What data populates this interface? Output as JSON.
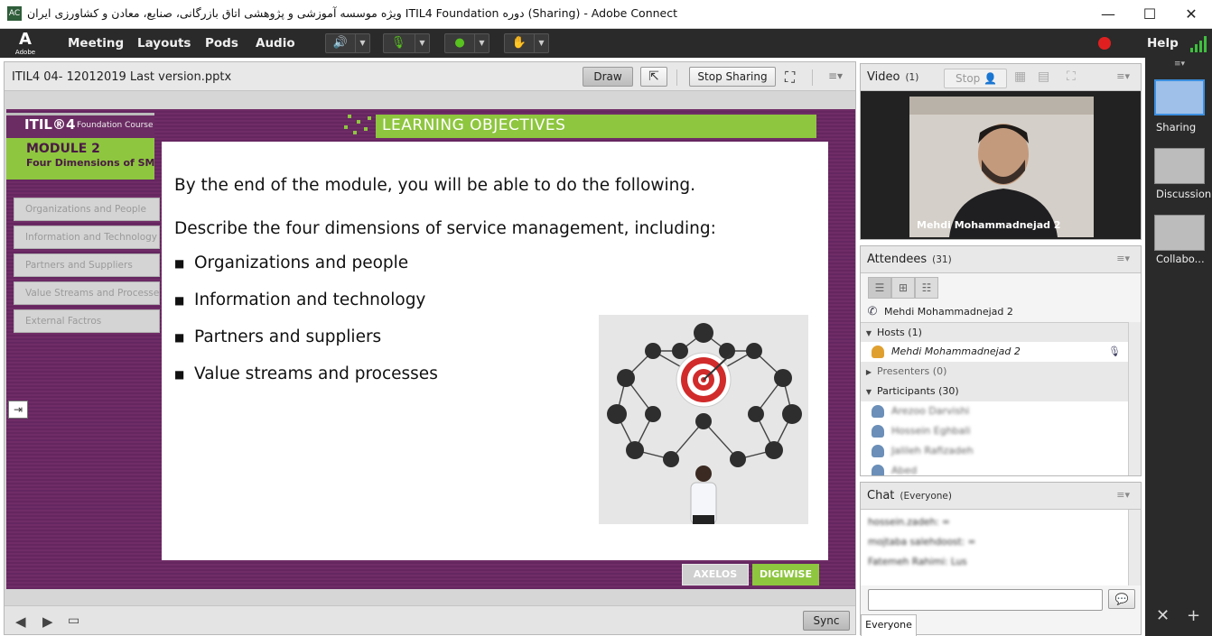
{
  "window": {
    "title": "ویژه موسسه آموزشی و پژوهشی اتاق بازرگانی، صنایع، معادن و کشاورزی ایران ITIL4 Foundation دوره (Sharing) - Adobe Connect",
    "minimize": "—",
    "maximize": "☐",
    "close": "✕"
  },
  "menubar": {
    "logo": "Adobe",
    "items": [
      "Meeting",
      "Layouts",
      "Pods",
      "Audio"
    ],
    "help": "Help"
  },
  "share_pod": {
    "filename": "ITIL4 04- 12012019 Last version.pptx",
    "draw_label": "Draw",
    "stop_sharing_label": "Stop Sharing",
    "sync_label": "Sync"
  },
  "slide": {
    "brand": "ITIL®4",
    "brand_sub": "Foundation Course",
    "module_title": "MODULE 2",
    "module_sub": "Four Dimensions of SM",
    "side_items": [
      "Organizations and People",
      "Information and Technology",
      "Partners and Suppliers",
      "Value Streams and Processes",
      "External Factros"
    ],
    "header": "LEARNING OBJECTIVES",
    "lead": "By the end of the module, you will be able to do the following.",
    "desc": "Describe the four dimensions of service management, including:",
    "bullets": [
      "Organizations and people",
      "Information and technology",
      "Partners and suppliers",
      "Value streams and processes"
    ],
    "logo_left": "AXELOS",
    "logo_right": "DIGIWISE"
  },
  "video_pod": {
    "title": "Video",
    "count": "(1)",
    "stop_label": "Stop",
    "speaker_name": "Mehdi Mohammadnejad 2"
  },
  "attendees_pod": {
    "title": "Attendees",
    "count": "(31)",
    "current_user": "Mehdi Mohammadnejad 2",
    "hosts_label": "Hosts (1)",
    "host_name": "Mehdi Mohammadnejad 2",
    "presenters_label": "Presenters (0)",
    "participants_label": "Participants (30)",
    "participants": [
      "Arezoo Darvishi",
      "Hossein Eghbali",
      "Jalileh Rafizadeh",
      "Abed"
    ]
  },
  "chat_pod": {
    "title": "Chat",
    "scope": "(Everyone)",
    "messages": [
      "hossein.zadeh: =",
      "mojtaba salehdoost: =",
      "Fatemeh Rahimi: Lus"
    ],
    "input_value": "",
    "tab_label": "Everyone"
  },
  "layouts_rail": {
    "items": [
      "Sharing",
      "Discussion",
      "Collabo..."
    ]
  },
  "colors": {
    "slide_purple": "#6c2a63",
    "slide_green": "#8ec63f",
    "menubar_bg": "#2a2a2a",
    "active_blue": "#3c8fe0"
  }
}
